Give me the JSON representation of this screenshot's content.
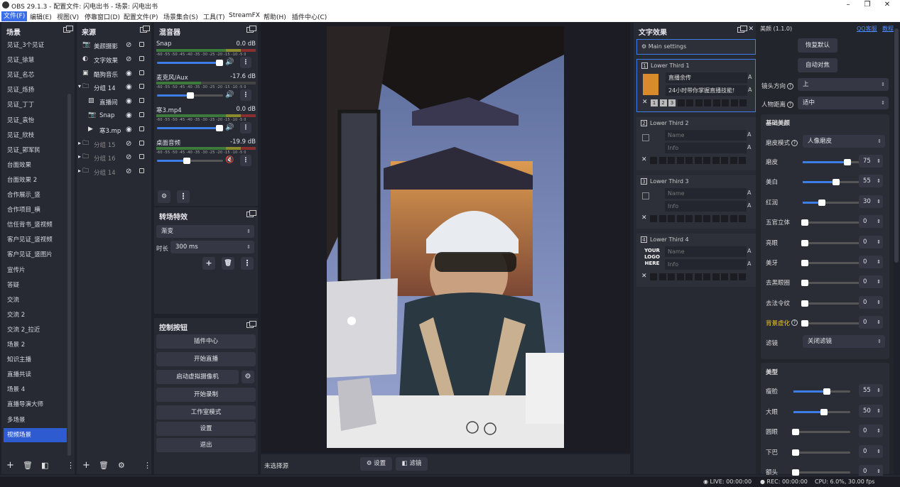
{
  "titlebar": {
    "title": "OBS 29.1.3 - 配置文件: 闪电出书 - 场景: 闪电出书"
  },
  "menu": [
    "文件(F)",
    "编辑(E)",
    "视图(V)",
    "停靠窗口(D)",
    "配置文件(P)",
    "场景集合(S)",
    "工具(T)",
    "StreamFX",
    "帮助(H)",
    "插件中心(C)"
  ],
  "scenes": {
    "title": "场景",
    "items": [
      "见证_3个见证",
      "见证_徐慧",
      "见证_名芯",
      "见证_烁扬",
      "见证_丁丁",
      "见证_袁怡",
      "见证_欣枝",
      "见证_郭军民",
      "台面效果",
      "台面效果 2",
      "合作展示_竖",
      "合作项目_横",
      "信任背书_竖视频",
      "客户见证_竖视频",
      "客户见证_竖图片",
      "宣传片",
      "答疑",
      "交流",
      "交流 2",
      "交流 2_拉近",
      "场景 2",
      "知识主播",
      "直播共读",
      "场景 4",
      "直播导演大师",
      "多场景",
      "视频场景"
    ],
    "selected": "视频场景"
  },
  "sources": {
    "title": "来源",
    "items": [
      {
        "icon": "camera",
        "name": "美颜摄影"
      },
      {
        "icon": "globe",
        "name": "文字效果"
      },
      {
        "icon": "window",
        "name": "酷狗音乐"
      },
      {
        "icon": "folder",
        "name": "分组 14"
      },
      {
        "icon": "image",
        "name": "直播间"
      },
      {
        "icon": "camera",
        "name": "Snap"
      },
      {
        "icon": "play",
        "name": "寒3.mp"
      },
      {
        "icon": "folder",
        "name": "分组 15"
      },
      {
        "icon": "folder",
        "name": "分组 16"
      },
      {
        "icon": "folder",
        "name": "分组 14"
      }
    ]
  },
  "mixer": {
    "title": "混音器",
    "scale": "-60 -55 -50 -45 -40 -35 -30 -25 -20 -15 -10 -5 0",
    "channels": [
      {
        "name": "Snap",
        "db": "0.0 dB",
        "level": 0.95,
        "muted": false
      },
      {
        "name": "麦克风/Aux",
        "db": "-17.6 dB",
        "level": 0.5,
        "muted": false
      },
      {
        "name": "寒3.mp4",
        "db": "0.0 dB",
        "level": 0.95,
        "muted": false
      },
      {
        "name": "桌面音频",
        "db": "-19.9 dB",
        "level": 0.45,
        "muted": true
      }
    ]
  },
  "transitions": {
    "title": "转场特效",
    "selected": "渐变",
    "duration_label": "时长",
    "duration": "300 ms"
  },
  "controls": {
    "title": "控制按钮",
    "buttons": [
      "插件中心",
      "开始直播",
      "启动虚拟摄像机",
      "开始录制",
      "工作室模式",
      "设置",
      "退出"
    ]
  },
  "preview_bar": {
    "status": "未选择源",
    "settings": "设置",
    "filters": "滤镜"
  },
  "text_effects": {
    "title": "文字效果",
    "main_settings": "Main settings",
    "thirds": [
      {
        "label": "Lower Third 1",
        "num": "1",
        "name": "直播余传",
        "info": "24小时带你掌握直播技能!"
      },
      {
        "label": "Lower Third 2",
        "num": "2",
        "name": "Name",
        "info": "Info"
      },
      {
        "label": "Lower Third 3",
        "num": "3",
        "name": "Name",
        "info": "Info"
      },
      {
        "label": "Lower Third 4",
        "num": "4",
        "name": "Name",
        "info": "Info",
        "logo": "YOUR LOGO HERE"
      }
    ]
  },
  "beauty": {
    "version": "美颜 (1.1.0)",
    "link_qq": "QQ客服",
    "link_tutorial": "教程",
    "btn_default": "恢复默认",
    "btn_auto": "自动对焦",
    "lens_dir_label": "镜头方向",
    "lens_dir": "上",
    "distance_label": "人物距离",
    "distance": "适中",
    "basic_title": "基础美颜",
    "mode_label": "磨皮模式",
    "mode": "人像磨皮",
    "basic_sliders": [
      {
        "label": "磨皮",
        "value": 75
      },
      {
        "label": "美白",
        "value": 55
      },
      {
        "label": "红润",
        "value": 30
      },
      {
        "label": "五官立体",
        "value": 0
      },
      {
        "label": "亮眼",
        "value": 0
      },
      {
        "label": "美牙",
        "value": 0
      },
      {
        "label": "去黑眼圈",
        "value": 0
      },
      {
        "label": "去法令纹",
        "value": 0
      },
      {
        "label": "背景虚化",
        "value": 0
      }
    ],
    "filter_label": "滤镜",
    "filter": "关闭滤镜",
    "shape_title": "美型",
    "shape_sliders": [
      {
        "label": "瘦脸",
        "value": 55
      },
      {
        "label": "大眼",
        "value": 50
      },
      {
        "label": "圆眼",
        "value": 0
      },
      {
        "label": "下巴",
        "value": 0
      },
      {
        "label": "额头",
        "value": 0
      }
    ]
  },
  "statusbar": {
    "live": "LIVE: 00:00:00",
    "rec": "REC: 00:00:00",
    "cpu": "CPU: 6.0%, 30.00 fps"
  },
  "colors": {
    "accent": "#2f5bd0",
    "bg": "#1f212a",
    "panel": "#272a33",
    "highlight": "#f0c830"
  }
}
